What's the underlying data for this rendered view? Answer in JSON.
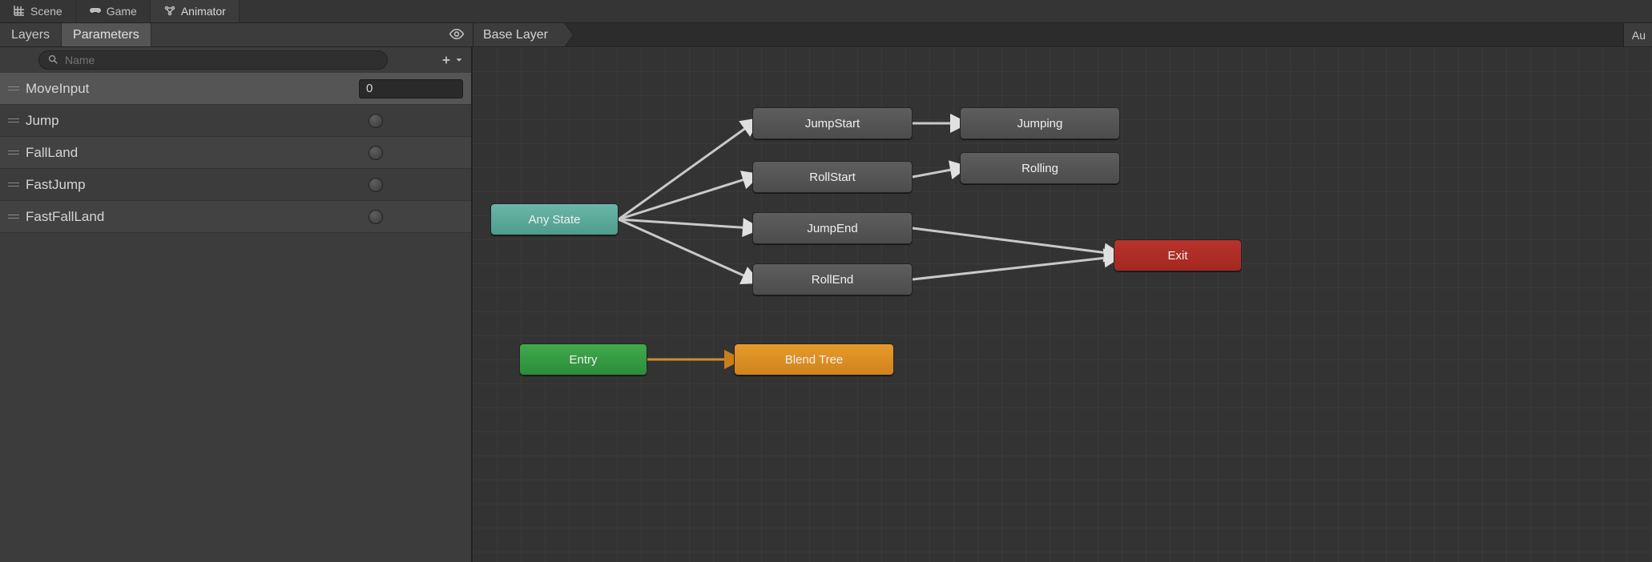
{
  "editor_tabs": [
    {
      "label": "Scene",
      "icon": "scene-icon"
    },
    {
      "label": "Game",
      "icon": "game-icon"
    },
    {
      "label": "Animator",
      "icon": "animator-icon",
      "active": true
    }
  ],
  "subtabs": {
    "layers": "Layers",
    "parameters": "Parameters",
    "active": "Parameters"
  },
  "breadcrumb": {
    "path": "Base Layer"
  },
  "right_label": "Au",
  "search": {
    "placeholder": "Name",
    "value": ""
  },
  "parameters": [
    {
      "name": "MoveInput",
      "kind": "float",
      "value": "0",
      "selected": true
    },
    {
      "name": "Jump",
      "kind": "trigger"
    },
    {
      "name": "FallLand",
      "kind": "trigger"
    },
    {
      "name": "FastJump",
      "kind": "trigger"
    },
    {
      "name": "FastFallLand",
      "kind": "trigger"
    }
  ],
  "graph": {
    "nodes": {
      "any_state": {
        "label": "Any State"
      },
      "jump_start": {
        "label": "JumpStart"
      },
      "jumping": {
        "label": "Jumping"
      },
      "roll_start": {
        "label": "RollStart"
      },
      "rolling": {
        "label": "Rolling"
      },
      "jump_end": {
        "label": "JumpEnd"
      },
      "roll_end": {
        "label": "RollEnd"
      },
      "entry": {
        "label": "Entry"
      },
      "blend_tree": {
        "label": "Blend Tree"
      },
      "exit": {
        "label": "Exit"
      }
    }
  }
}
